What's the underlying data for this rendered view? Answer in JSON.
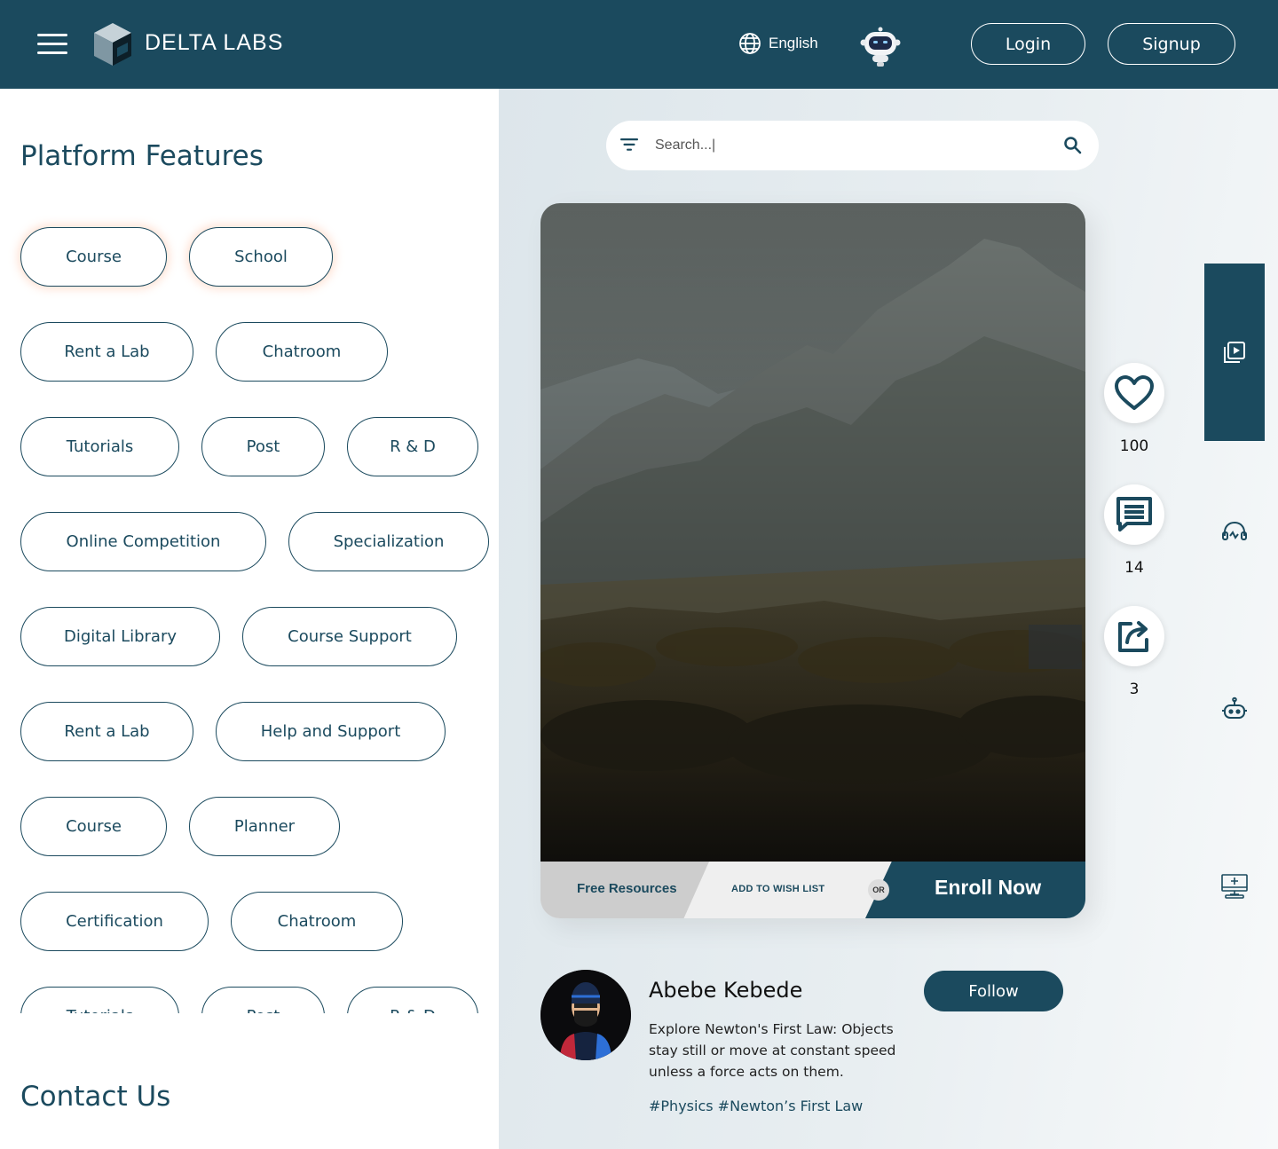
{
  "header": {
    "brand": "DELTA LABS",
    "language": "English",
    "login_label": "Login",
    "signup_label": "Signup",
    "background_color": "#1b4a5e"
  },
  "sidebar": {
    "features_title": "Platform Features",
    "contact_title": "Contact Us",
    "chips": [
      {
        "label": "Course"
      },
      {
        "label": "School"
      },
      {
        "label": "Rent a Lab"
      },
      {
        "label": "Chatroom"
      },
      {
        "label": "Tutorials"
      },
      {
        "label": "Post"
      },
      {
        "label": "R & D"
      },
      {
        "label": "Online Competition"
      },
      {
        "label": "Specialization"
      },
      {
        "label": "Digital Library"
      },
      {
        "label": "Course Support"
      },
      {
        "label": "Rent a Lab"
      },
      {
        "label": "Help and Support"
      },
      {
        "label": "Course"
      },
      {
        "label": "Planner"
      },
      {
        "label": "Certification"
      },
      {
        "label": "Chatroom"
      },
      {
        "label": "Tutorials"
      },
      {
        "label": "Post"
      },
      {
        "label": "R & D"
      }
    ]
  },
  "search": {
    "placeholder": "Search...|"
  },
  "card": {
    "free_resources": "Free Resources",
    "add_to_wishlist": "ADD TO WISH LIST",
    "or_label": "OR",
    "enroll_label": "Enroll Now"
  },
  "actions": {
    "likes": "100",
    "comments": "14",
    "shares": "3"
  },
  "post": {
    "author": "Abebe Kebede",
    "description": "Explore Newton's First Law: Objects stay still or move at constant speed unless a force acts on them.",
    "tags": "#Physics #Newton’s First Law",
    "follow_label": "Follow"
  },
  "side_rail": {
    "icons": [
      "video-library-icon",
      "headset-icon",
      "robot-icon",
      "computer-lab-icon"
    ]
  },
  "colors": {
    "primary": "#1b4a5e",
    "right_bg": "#e3eaee"
  }
}
